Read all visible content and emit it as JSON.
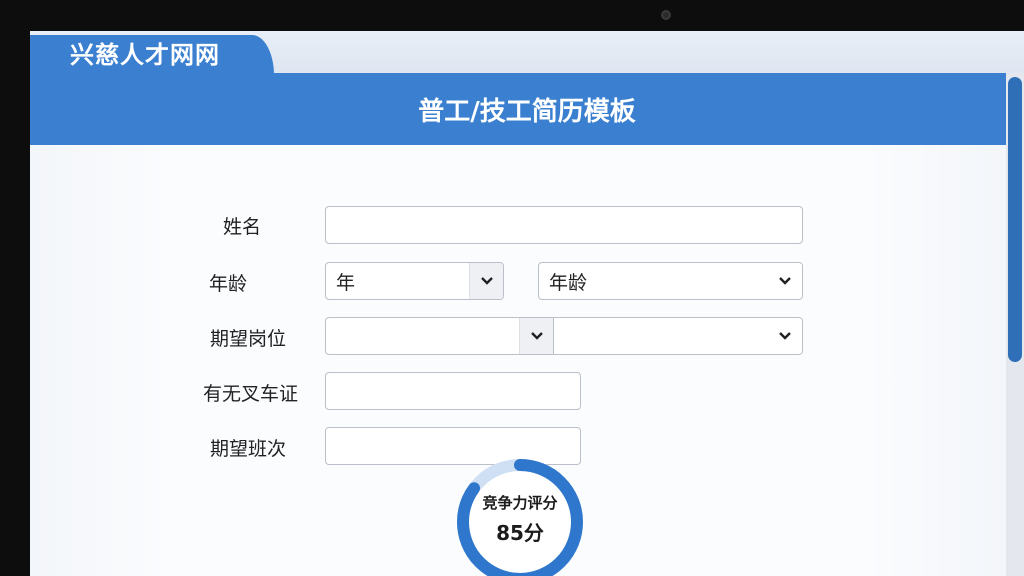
{
  "site": {
    "name": "兴慈人才网网"
  },
  "page": {
    "title": "普工/技工简历模板"
  },
  "form": {
    "name": {
      "label": "姓名",
      "value": ""
    },
    "age": {
      "label": "年龄",
      "year_select": {
        "value": "年"
      },
      "age_select": {
        "value": "年龄"
      }
    },
    "position": {
      "label": "期望岗位",
      "select1": {
        "value": ""
      },
      "select2": {
        "value": ""
      }
    },
    "forklift": {
      "label": "有无叉车证",
      "value": ""
    },
    "shift": {
      "label": "期望班次",
      "value": ""
    }
  },
  "score": {
    "label": "竞争力评分",
    "value": "85分",
    "percent": 85
  },
  "colors": {
    "brand": "#3a7fd0",
    "ring": "#2f77cc",
    "ring_track": "#cfe0f4"
  },
  "icons": {
    "dropdown": "chevron-down-icon"
  }
}
